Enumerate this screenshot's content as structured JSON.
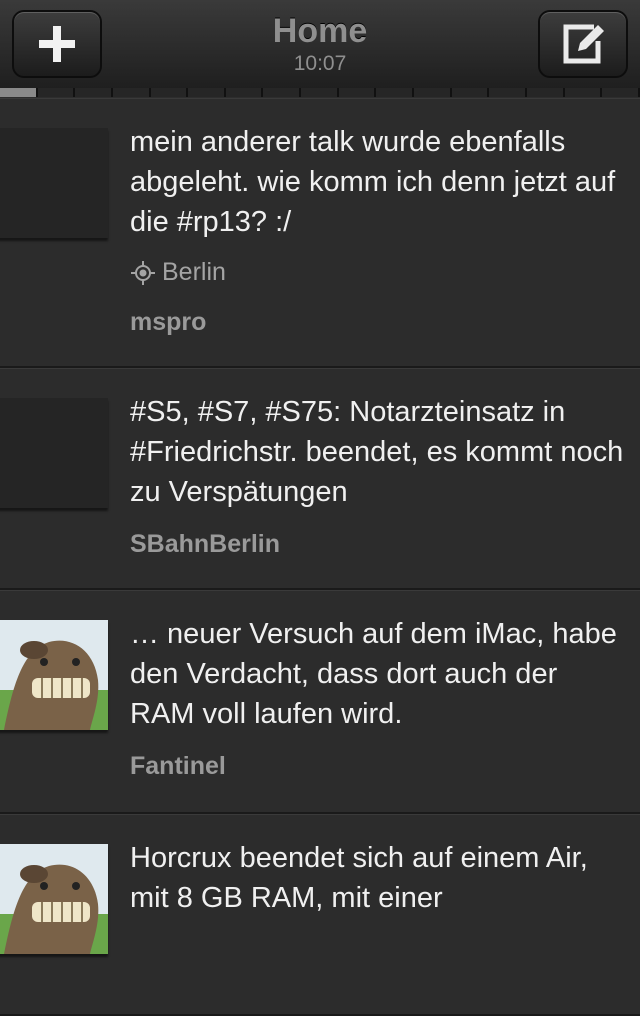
{
  "header": {
    "title": "Home",
    "time": "10:07"
  },
  "icons": {
    "left_button": "plus-icon",
    "right_button": "compose-icon",
    "location": "location-crosshair-icon"
  },
  "tweets": [
    {
      "text": "mein anderer talk wurde ebenfalls abgeleht. wie komm ich denn jetzt auf die #rp13? :/",
      "location": "Berlin",
      "user": "mspro"
    },
    {
      "text": "#S5, #S7, #S75: Notarzteinsatz in #Friedrichstr. beendet, es kommt noch zu Verspätungen",
      "user": "SBahnBerlin"
    },
    {
      "text": "… neuer Versuch auf dem iMac, habe den Verdacht, dass dort auch der RAM voll laufen wird.",
      "user": "Fantinel"
    },
    {
      "text": "Horcrux beendet sich auf einem Air, mit 8 GB RAM, mit einer",
      "user": ""
    }
  ]
}
